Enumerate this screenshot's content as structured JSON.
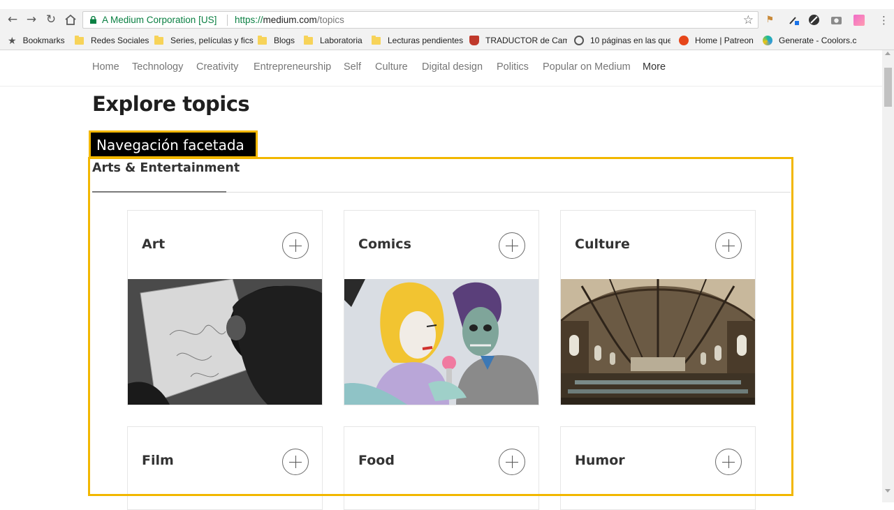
{
  "browser": {
    "secure_label": "A Medium Corporation [US]",
    "url_scheme": "https://",
    "url_host": "medium.com",
    "url_path": "/topics",
    "bookmarks": [
      {
        "label": "Bookmarks",
        "icon": "star-icon"
      },
      {
        "label": "Redes Sociales",
        "icon": "folder-icon"
      },
      {
        "label": "Series, películas y fics",
        "icon": "folder-icon"
      },
      {
        "label": "Blogs",
        "icon": "folder-icon"
      },
      {
        "label": "Laboratoria",
        "icon": "folder-icon"
      },
      {
        "label": "Lecturas pendientes",
        "icon": "folder-icon"
      },
      {
        "label": "TRADUCTOR de Cam",
        "icon": "shield-icon"
      },
      {
        "label": "10 páginas en las que",
        "icon": "site-icon"
      },
      {
        "label": "Home | Patreon",
        "icon": "patreon-icon"
      },
      {
        "label": "Generate - Coolors.cc",
        "icon": "coolors-icon"
      }
    ]
  },
  "topics_nav": [
    "Home",
    "Technology",
    "Creativity",
    "Entrepreneurship",
    "Self",
    "Culture",
    "Digital design",
    "Politics",
    "Popular on Medium",
    "More"
  ],
  "page_title": "Explore topics",
  "annotation_label": "Navegación facetada",
  "category_tab": "Arts & Entertainment",
  "cards": [
    {
      "name": "Art",
      "image": "sketching-artist-photo"
    },
    {
      "name": "Comics",
      "image": "pop-art-comic-couple"
    },
    {
      "name": "Culture",
      "image": "vaulted-library-hall-photo"
    },
    {
      "name": "Film"
    },
    {
      "name": "Food"
    },
    {
      "name": "Humor"
    }
  ],
  "colors": {
    "annotation_accent": "#f2b700",
    "secure_green": "#0b8043",
    "chrome_bg": "#f2f2f2"
  }
}
